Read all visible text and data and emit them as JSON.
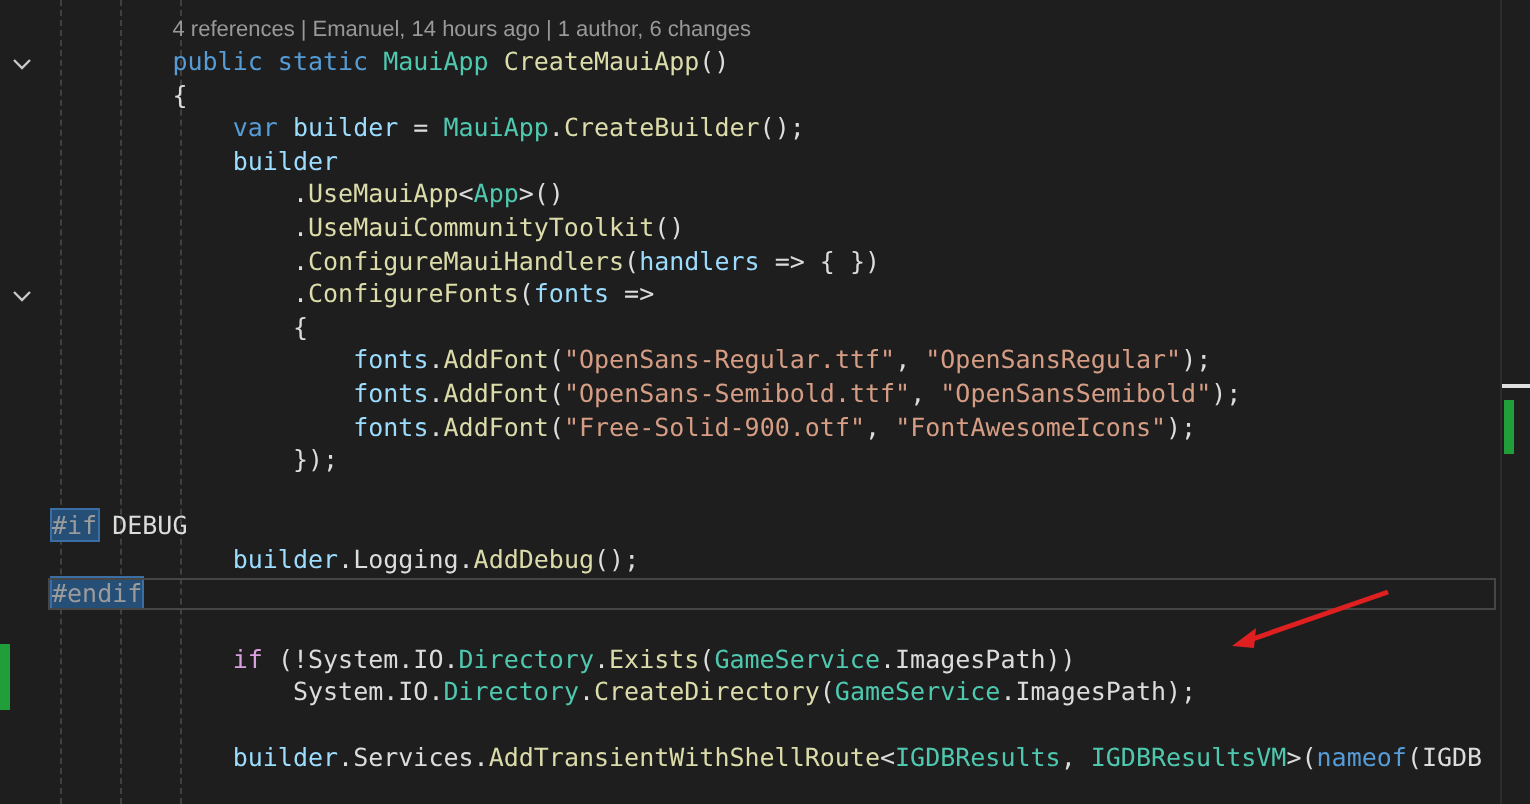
{
  "editor": {
    "lines": [
      {
        "children": [
          {
            "children": [
              {
                "kind": "codelens",
                "links": [
                  "4 references",
                  "Emanuel, 14 hours ago",
                  "1 author, 6 changes"
                ],
                "separator": "|"
              },
              {
                "foldable": true,
                "tokens": [
                  {
                    "kind": "keyword",
                    "text": "public static "
                  },
                  {
                    "kind": "type",
                    "text": "MauiApp "
                  },
                  {
                    "kind": "method",
                    "text": "CreateMauiApp"
                  },
                  {
                    "kind": "plain",
                    "text": "()"
                  }
                ]
              },
              {
                "tokens": [
                  {
                    "kind": "plain",
                    "text": "{"
                  }
                ]
              },
              {
                "children": [
                  {
                    "tokens": [
                      {
                        "kind": "keyword",
                        "text": "var "
                      },
                      {
                        "kind": "variable",
                        "text": "builder"
                      },
                      {
                        "kind": "plain",
                        "text": " = "
                      },
                      {
                        "kind": "type",
                        "text": "MauiApp"
                      },
                      {
                        "kind": "plain",
                        "text": "."
                      },
                      {
                        "kind": "method",
                        "text": "CreateBuilder"
                      },
                      {
                        "kind": "plain",
                        "text": "();"
                      }
                    ]
                  },
                  {
                    "tokens": [
                      {
                        "kind": "variable",
                        "text": "builder"
                      }
                    ]
                  },
                  {
                    "children": [
                      {
                        "tokens": [
                          {
                            "kind": "plain",
                            "text": "."
                          },
                          {
                            "kind": "method",
                            "text": "UseMauiApp"
                          },
                          {
                            "kind": "plain",
                            "text": "<"
                          },
                          {
                            "kind": "type",
                            "text": "App"
                          },
                          {
                            "kind": "plain",
                            "text": ">()"
                          }
                        ]
                      },
                      {
                        "tokens": [
                          {
                            "kind": "plain",
                            "text": "."
                          },
                          {
                            "kind": "method",
                            "text": "UseMauiCommunityToolkit"
                          },
                          {
                            "kind": "plain",
                            "text": "()"
                          }
                        ]
                      },
                      {
                        "tokens": [
                          {
                            "kind": "plain",
                            "text": "."
                          },
                          {
                            "kind": "method",
                            "text": "ConfigureMauiHandlers"
                          },
                          {
                            "kind": "plain",
                            "text": "("
                          },
                          {
                            "kind": "variable",
                            "text": "handlers"
                          },
                          {
                            "kind": "plain",
                            "text": " => { })"
                          }
                        ]
                      },
                      {
                        "foldable": true,
                        "tokens": [
                          {
                            "kind": "plain",
                            "text": "."
                          },
                          {
                            "kind": "method",
                            "text": "ConfigureFonts"
                          },
                          {
                            "kind": "plain",
                            "text": "("
                          },
                          {
                            "kind": "variable",
                            "text": "fonts"
                          },
                          {
                            "kind": "plain",
                            "text": " =>"
                          }
                        ]
                      },
                      {
                        "tokens": [
                          {
                            "kind": "plain",
                            "text": "{"
                          }
                        ]
                      },
                      {
                        "children": [
                          {
                            "tokens": [
                              {
                                "kind": "variable",
                                "text": "fonts"
                              },
                              {
                                "kind": "plain",
                                "text": "."
                              },
                              {
                                "kind": "method",
                                "text": "AddFont"
                              },
                              {
                                "kind": "plain",
                                "text": "("
                              },
                              {
                                "kind": "string",
                                "text": "\"OpenSans-Regular.ttf\""
                              },
                              {
                                "kind": "plain",
                                "text": ", "
                              },
                              {
                                "kind": "string",
                                "text": "\"OpenSansRegular\""
                              },
                              {
                                "kind": "plain",
                                "text": ");"
                              }
                            ]
                          },
                          {
                            "tokens": [
                              {
                                "kind": "variable",
                                "text": "fonts"
                              },
                              {
                                "kind": "plain",
                                "text": "."
                              },
                              {
                                "kind": "method",
                                "text": "AddFont"
                              },
                              {
                                "kind": "plain",
                                "text": "("
                              },
                              {
                                "kind": "string",
                                "text": "\"OpenSans-Semibold.ttf\""
                              },
                              {
                                "kind": "plain",
                                "text": ", "
                              },
                              {
                                "kind": "string",
                                "text": "\"OpenSansSemibold\""
                              },
                              {
                                "kind": "plain",
                                "text": ");"
                              }
                            ]
                          },
                          {
                            "tokens": [
                              {
                                "kind": "variable",
                                "text": "fonts"
                              },
                              {
                                "kind": "plain",
                                "text": "."
                              },
                              {
                                "kind": "method",
                                "text": "AddFont"
                              },
                              {
                                "kind": "plain",
                                "text": "("
                              },
                              {
                                "kind": "string",
                                "text": "\"Free-Solid-900.otf\""
                              },
                              {
                                "kind": "plain",
                                "text": ", "
                              },
                              {
                                "kind": "string",
                                "text": "\"FontAwesomeIcons\""
                              },
                              {
                                "kind": "plain",
                                "text": ");"
                              }
                            ]
                          }
                        ]
                      },
                      {
                        "tokens": [
                          {
                            "kind": "plain",
                            "text": "});"
                          }
                        ]
                      }
                    ]
                  }
                ]
              }
            ]
          }
        ]
      },
      {
        "kind": "blank"
      },
      {
        "tokens": [
          {
            "kind": "directive",
            "text": "#if"
          },
          {
            "kind": "plain",
            "text": " DEBUG"
          }
        ]
      },
      {
        "children": [
          {
            "children": [
              {
                "children": [
                  {
                    "tokens": [
                      {
                        "kind": "variable",
                        "text": "builder"
                      },
                      {
                        "kind": "plain",
                        "text": "."
                      },
                      {
                        "kind": "plain",
                        "text": "Logging"
                      },
                      {
                        "kind": "plain",
                        "text": "."
                      },
                      {
                        "kind": "method",
                        "text": "AddDebug"
                      },
                      {
                        "kind": "plain",
                        "text": "();"
                      }
                    ]
                  }
                ]
              }
            ]
          }
        ]
      },
      {
        "current": true,
        "tokens": [
          {
            "kind": "directive",
            "text": "#endif"
          }
        ]
      },
      {
        "kind": "blank"
      },
      {
        "children": [
          {
            "children": [
              {
                "children": [
                  {
                    "changed": true,
                    "tokens": [
                      {
                        "kind": "control",
                        "text": "if "
                      },
                      {
                        "kind": "plain",
                        "text": "(!System.IO."
                      },
                      {
                        "kind": "type",
                        "text": "Directory"
                      },
                      {
                        "kind": "plain",
                        "text": "."
                      },
                      {
                        "kind": "method",
                        "text": "Exists"
                      },
                      {
                        "kind": "plain",
                        "text": "("
                      },
                      {
                        "kind": "type",
                        "text": "GameService"
                      },
                      {
                        "kind": "plain",
                        "text": ".ImagesPath))"
                      }
                    ]
                  },
                  {
                    "children": [
                      {
                        "changed": true,
                        "tokens": [
                          {
                            "kind": "plain",
                            "text": "System.IO."
                          },
                          {
                            "kind": "type",
                            "text": "Directory"
                          },
                          {
                            "kind": "plain",
                            "text": "."
                          },
                          {
                            "kind": "method",
                            "text": "CreateDirectory"
                          },
                          {
                            "kind": "plain",
                            "text": "("
                          },
                          {
                            "kind": "type",
                            "text": "GameService"
                          },
                          {
                            "kind": "plain",
                            "text": ".ImagesPath);"
                          }
                        ]
                      }
                    ]
                  },
                  {
                    "kind": "blank"
                  },
                  {
                    "tokens": [
                      {
                        "kind": "variable",
                        "text": "builder"
                      },
                      {
                        "kind": "plain",
                        "text": ".Services."
                      },
                      {
                        "kind": "method",
                        "text": "AddTransientWithShellRoute"
                      },
                      {
                        "kind": "plain",
                        "text": "<"
                      },
                      {
                        "kind": "type",
                        "text": "IGDBResults"
                      },
                      {
                        "kind": "plain",
                        "text": ", "
                      },
                      {
                        "kind": "type",
                        "text": "IGDBResultsVM"
                      },
                      {
                        "kind": "plain",
                        "text": ">("
                      },
                      {
                        "kind": "keyword",
                        "text": "nameof"
                      },
                      {
                        "kind": "plain",
                        "text": "(IGDB"
                      }
                    ]
                  }
                ]
              }
            ]
          }
        ]
      }
    ]
  }
}
